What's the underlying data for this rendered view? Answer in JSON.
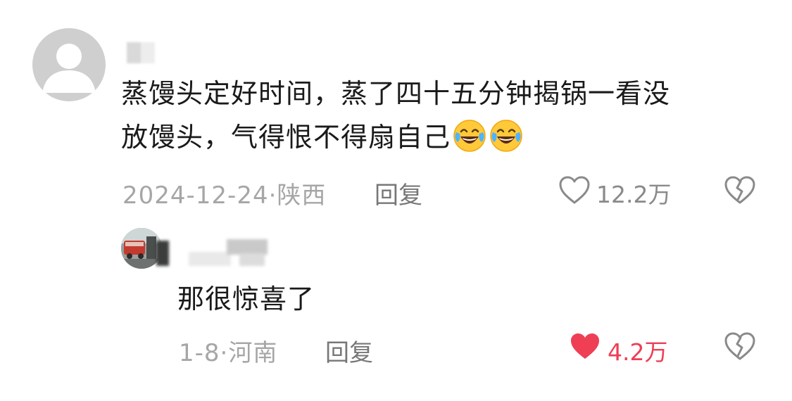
{
  "comment": {
    "text_line1": "蒸馒头定好时间，蒸了四十五分钟揭锅一看没",
    "text_line2": "放馒头，气得恨不得扇自己",
    "emojis": [
      "laugh-cry-emoji",
      "laugh-cry-emoji"
    ],
    "date": "2024-12-24",
    "separator": "·",
    "location": "陕西",
    "reply_label": "回复",
    "like_count": "12.2万",
    "liked": false
  },
  "reply": {
    "text": "那很惊喜了",
    "date": "1-8",
    "separator": "·",
    "location": "河南",
    "reply_label": "回复",
    "like_count": "4.2万",
    "liked": true
  },
  "colors": {
    "like_active": "#ee3f55",
    "meta_gray": "#a6a6a6",
    "text": "#1a1a1a"
  },
  "icons": [
    "default-avatar-icon",
    "heart-outline-icon",
    "heart-filled-icon",
    "broken-heart-icon"
  ]
}
